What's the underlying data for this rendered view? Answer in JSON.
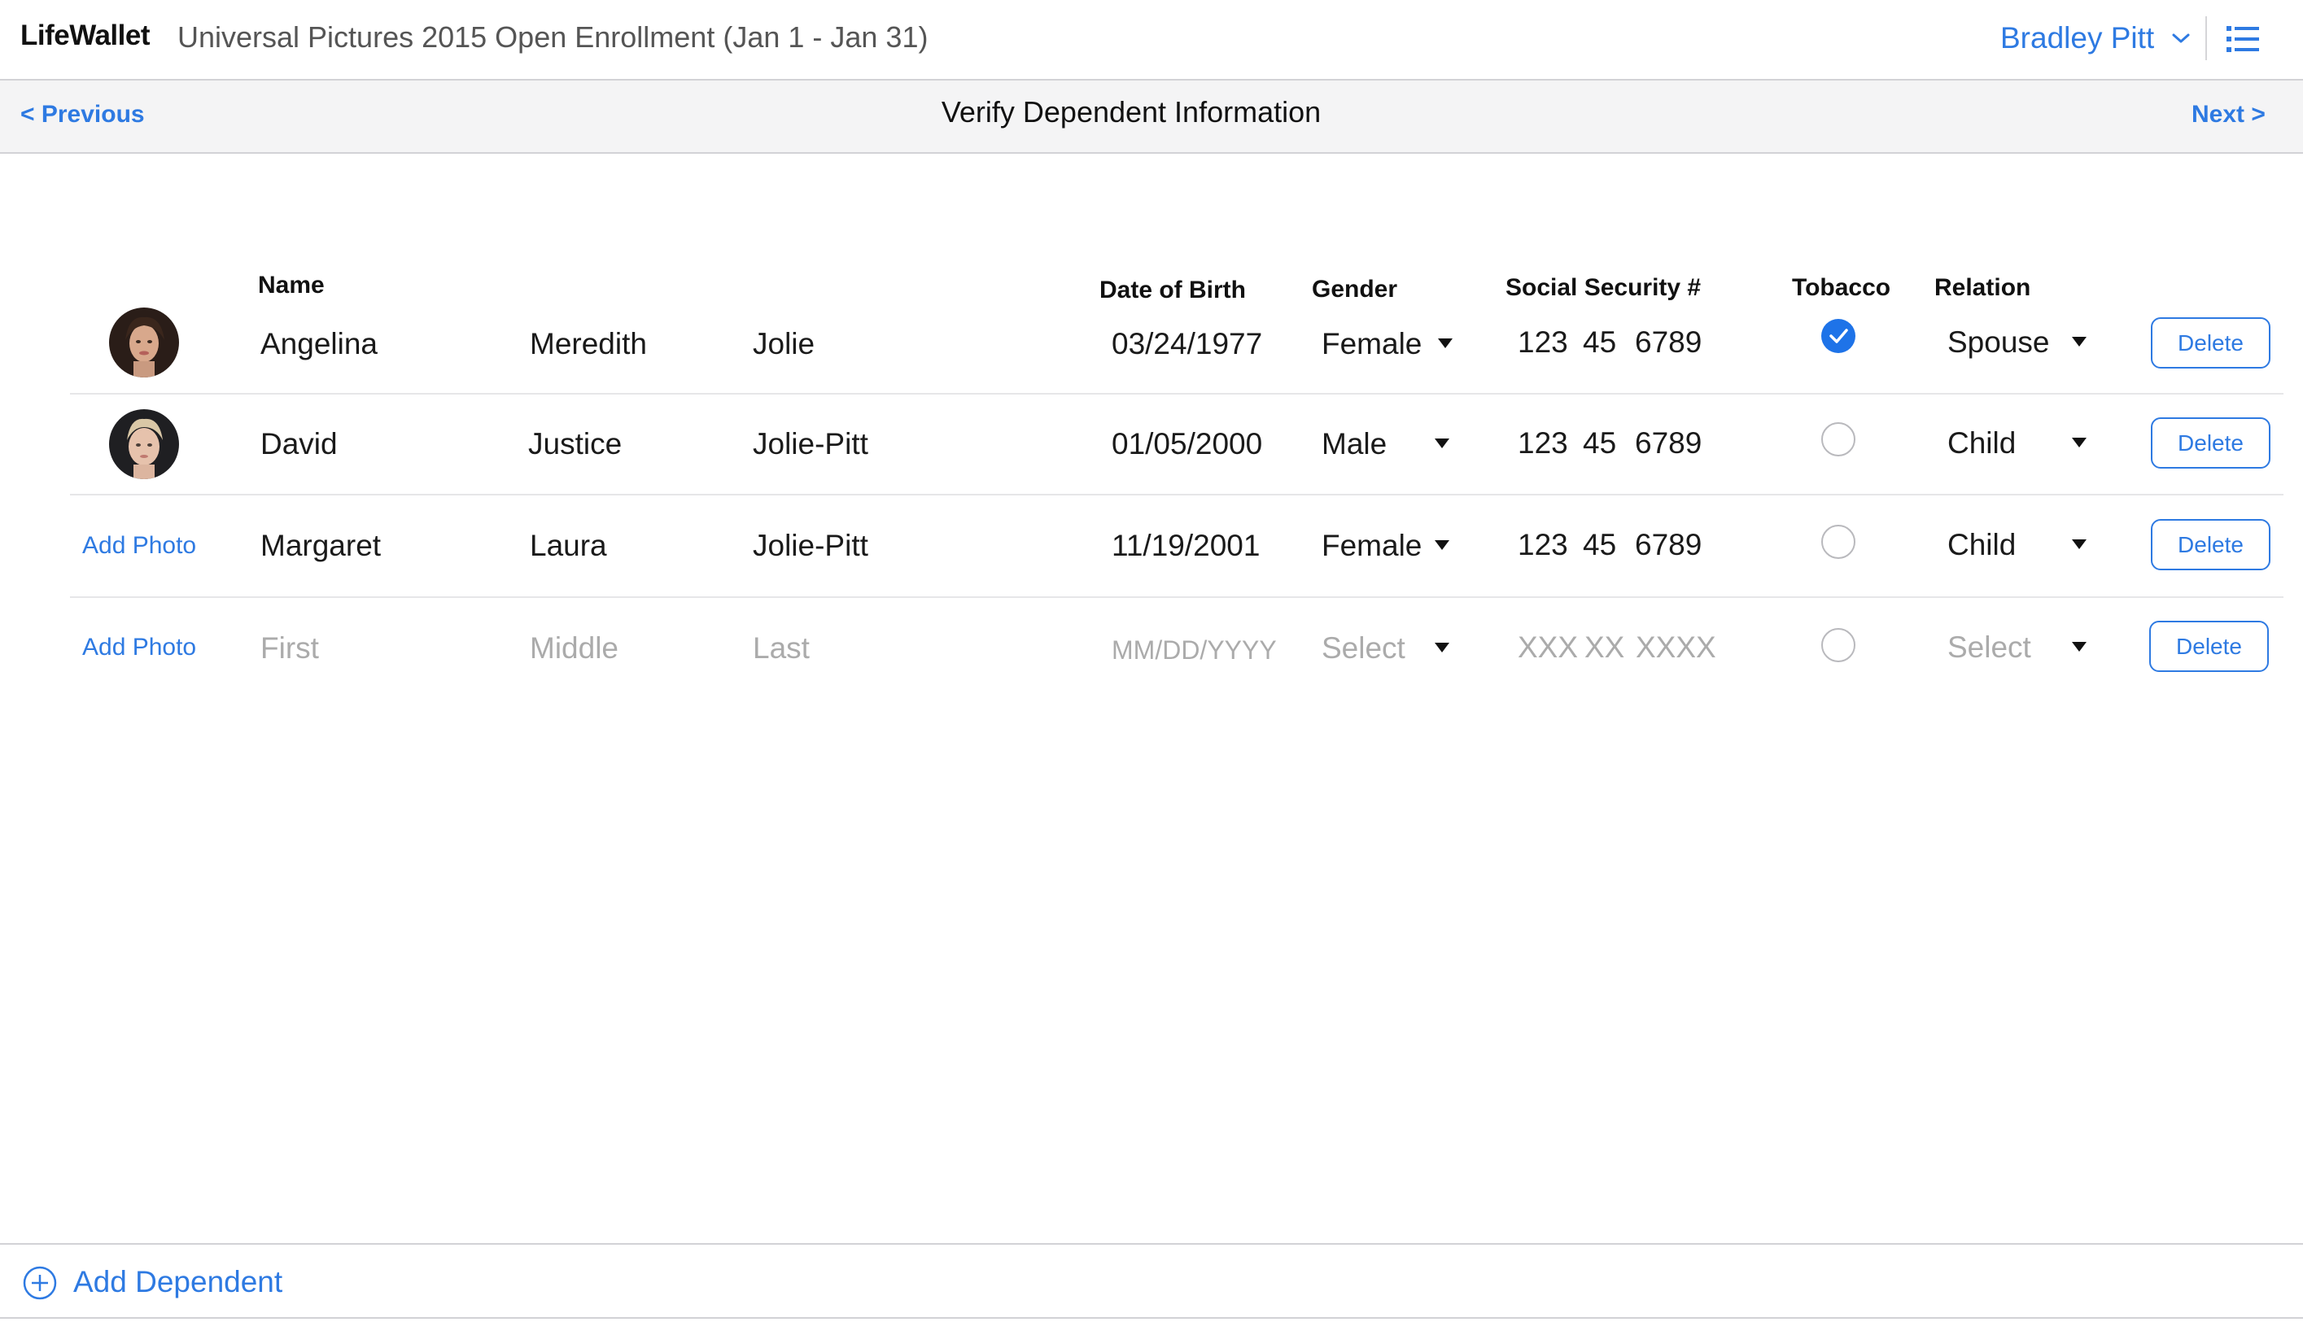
{
  "header": {
    "logo": "LifeWallet",
    "enrollment_title": "Universal Pictures 2015 Open Enrollment (Jan 1 - Jan 31)",
    "user_name": "Bradley Pitt"
  },
  "nav": {
    "previous_label": "< Previous",
    "page_title": "Verify Dependent Information",
    "next_label": "Next >"
  },
  "columns": {
    "name": "Name",
    "dob": "Date of Birth",
    "gender": "Gender",
    "ssn": "Social Security #",
    "tobacco": "Tobacco",
    "relation": "Relation"
  },
  "dependents": [
    {
      "photo": "avatar",
      "first": "Angelina",
      "middle": "Meredith",
      "last": "Jolie",
      "dob": "03/24/1977",
      "gender": "Female",
      "ssn1": "123",
      "ssn2": "45",
      "ssn3": "6789",
      "tobacco": true,
      "relation": "Spouse",
      "delete_label": "Delete"
    },
    {
      "photo": "avatar",
      "first": "David",
      "middle": "Justice",
      "last": "Jolie-Pitt",
      "dob": "01/05/2000",
      "gender": "Male",
      "ssn1": "123",
      "ssn2": "45",
      "ssn3": "6789",
      "tobacco": false,
      "relation": "Child",
      "delete_label": "Delete"
    },
    {
      "photo": "add",
      "add_photo_label": "Add Photo",
      "first": "Margaret",
      "middle": "Laura",
      "last": "Jolie-Pitt",
      "dob": "11/19/2001",
      "gender": "Female",
      "ssn1": "123",
      "ssn2": "45",
      "ssn3": "6789",
      "tobacco": false,
      "relation": "Child",
      "delete_label": "Delete"
    }
  ],
  "new_dependent": {
    "add_photo_label": "Add Photo",
    "first_placeholder": "First",
    "middle_placeholder": "Middle",
    "last_placeholder": "Last",
    "dob_placeholder": "MM/DD/YYYY",
    "gender_placeholder": "Select",
    "ssn1_placeholder": "XXX",
    "ssn2_placeholder": "XX",
    "ssn3_placeholder": "XXXX",
    "tobacco": false,
    "relation_placeholder": "Select",
    "delete_label": "Delete"
  },
  "footer": {
    "add_dependent_label": "Add Dependent"
  },
  "colors": {
    "accent": "#2e7ae2",
    "checked": "#1e73e8",
    "placeholder": "#ababab"
  },
  "icons": [
    "chevron-down-icon",
    "list-menu-icon",
    "caret-down-icon",
    "check-icon",
    "plus-circle-icon"
  ]
}
